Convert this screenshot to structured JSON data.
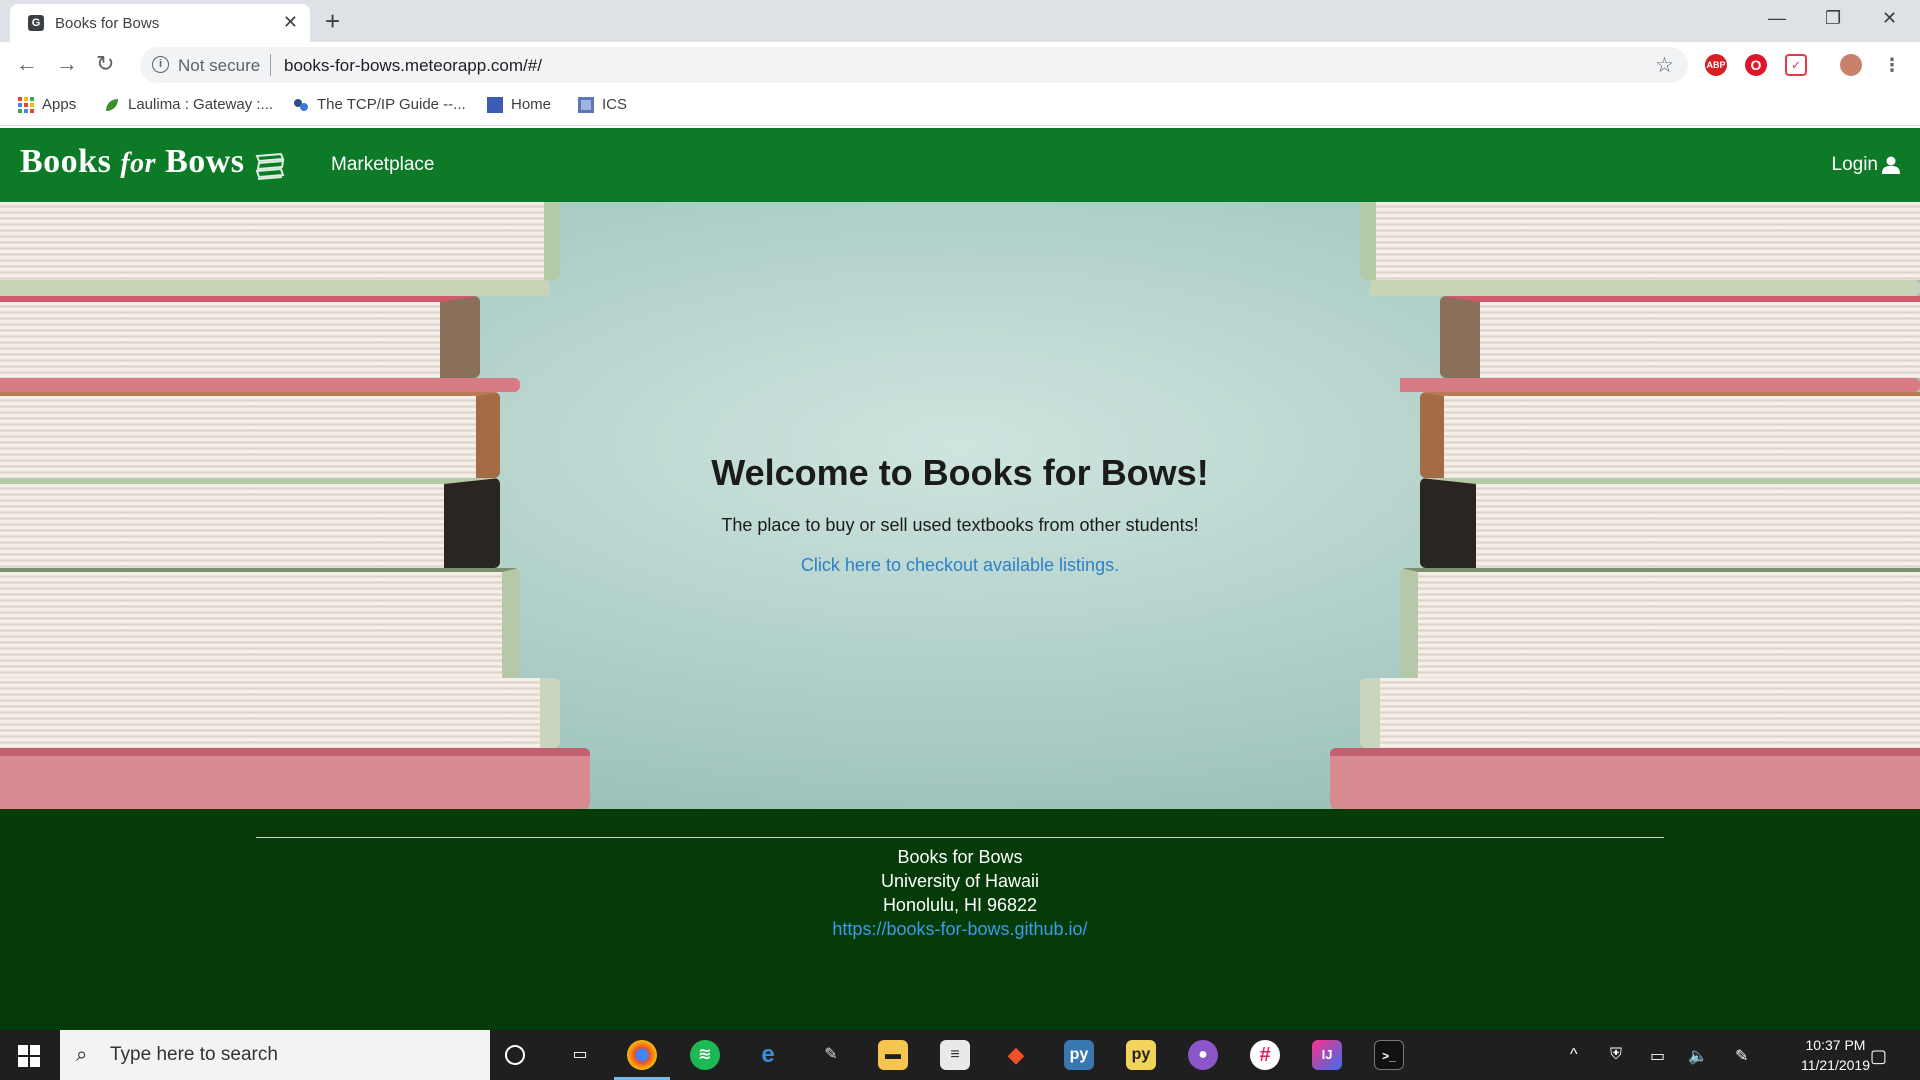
{
  "browser": {
    "tab_title": "Books for Bows",
    "new_tab": "+",
    "not_secure": "Not secure",
    "url": "books-for-bows.meteorapp.com/#/",
    "bookmarks": [
      {
        "label": "Apps",
        "icon": "apps-grid-icon"
      },
      {
        "label": "Laulima : Gateway :...",
        "icon": "laulima-icon"
      },
      {
        "label": "The TCP/IP Guide --...",
        "icon": "tcpip-guide-icon"
      },
      {
        "label": "Home",
        "icon": "home-bookmark-icon"
      },
      {
        "label": "ICS",
        "icon": "ics-bookmark-icon"
      }
    ],
    "extensions": [
      "ABP",
      "opera-icon",
      "pocket-icon",
      "profile-avatar"
    ]
  },
  "site": {
    "brand_prefix": "Books",
    "brand_for": "for",
    "brand_suffix": "Bows",
    "nav_marketplace": "Marketplace",
    "nav_login": "Login",
    "accent": "#0c7a26",
    "footer_bg": "#053b08",
    "hero": {
      "title": "Welcome to Books for Bows!",
      "subtitle": "The place to buy or sell used textbooks from other students!",
      "link": "Click here to checkout available listings."
    },
    "footer": {
      "name": "Books for Bows",
      "university": "University of Hawaii",
      "city": "Honolulu, HI 96822",
      "url": "https://books-for-bows.github.io/"
    }
  },
  "taskbar": {
    "search_placeholder": "Type here to search",
    "time": "10:37 PM",
    "date": "11/21/2019",
    "apps": [
      "cortana-icon",
      "task-view-icon",
      "chrome-icon",
      "spotify-icon",
      "edge-icon",
      "paint-icon",
      "file-explorer-icon",
      "notepad-icon",
      "git-icon",
      "python-icon",
      "folder-python-icon",
      "github-desktop-icon",
      "slack-icon",
      "intellij-icon",
      "terminal-icon"
    ]
  }
}
